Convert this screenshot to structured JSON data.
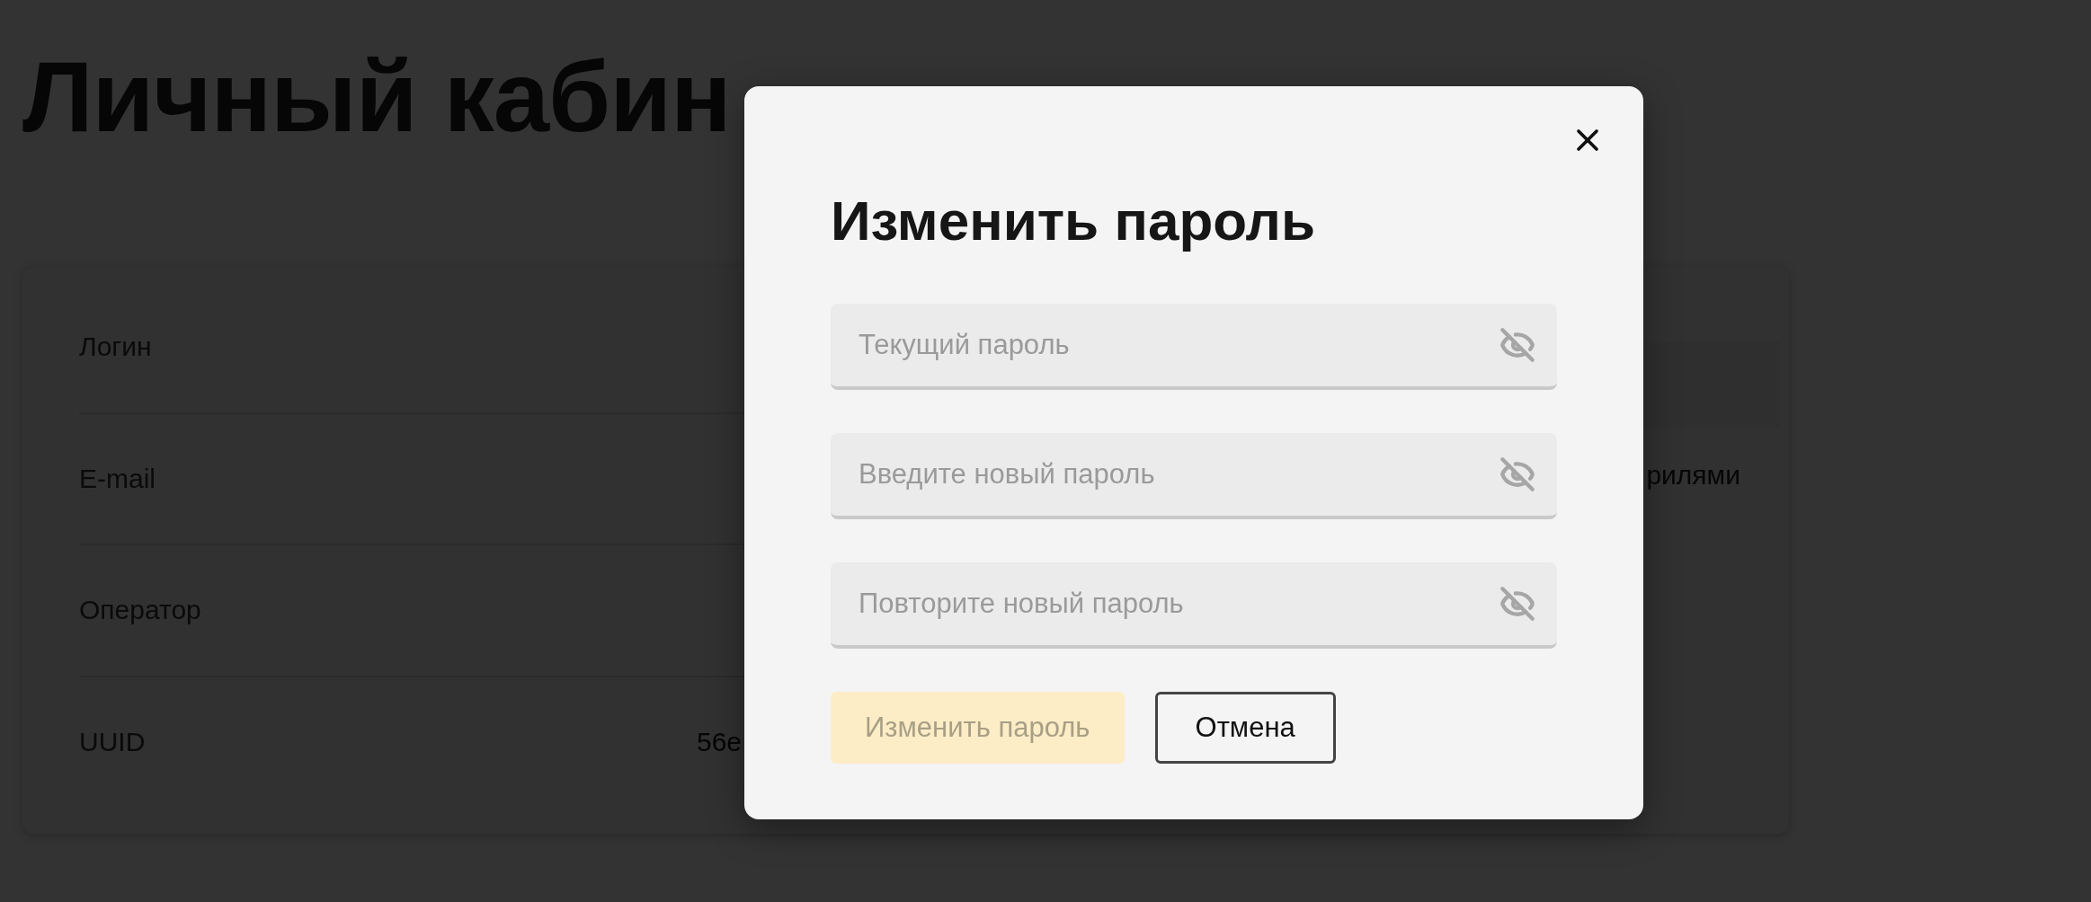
{
  "page": {
    "title": "Личный кабин",
    "account_fields": [
      {
        "label": "Логин"
      },
      {
        "label": "E-mail"
      },
      {
        "label": "Оператор"
      },
      {
        "label": "UUID",
        "value": "56e"
      }
    ],
    "side_text": "рилями"
  },
  "dialog": {
    "title": "Изменить пароль",
    "fields": [
      {
        "placeholder": "Текущий пароль",
        "masked": true
      },
      {
        "placeholder": "Введите новый пароль",
        "masked": true
      },
      {
        "placeholder": "Повторите новый пароль",
        "masked": true
      }
    ],
    "buttons": [
      {
        "label": "Изменить пароль",
        "kind": "primary",
        "disabled": true
      },
      {
        "label": "Отмена",
        "kind": "secondary",
        "disabled": false
      }
    ]
  }
}
